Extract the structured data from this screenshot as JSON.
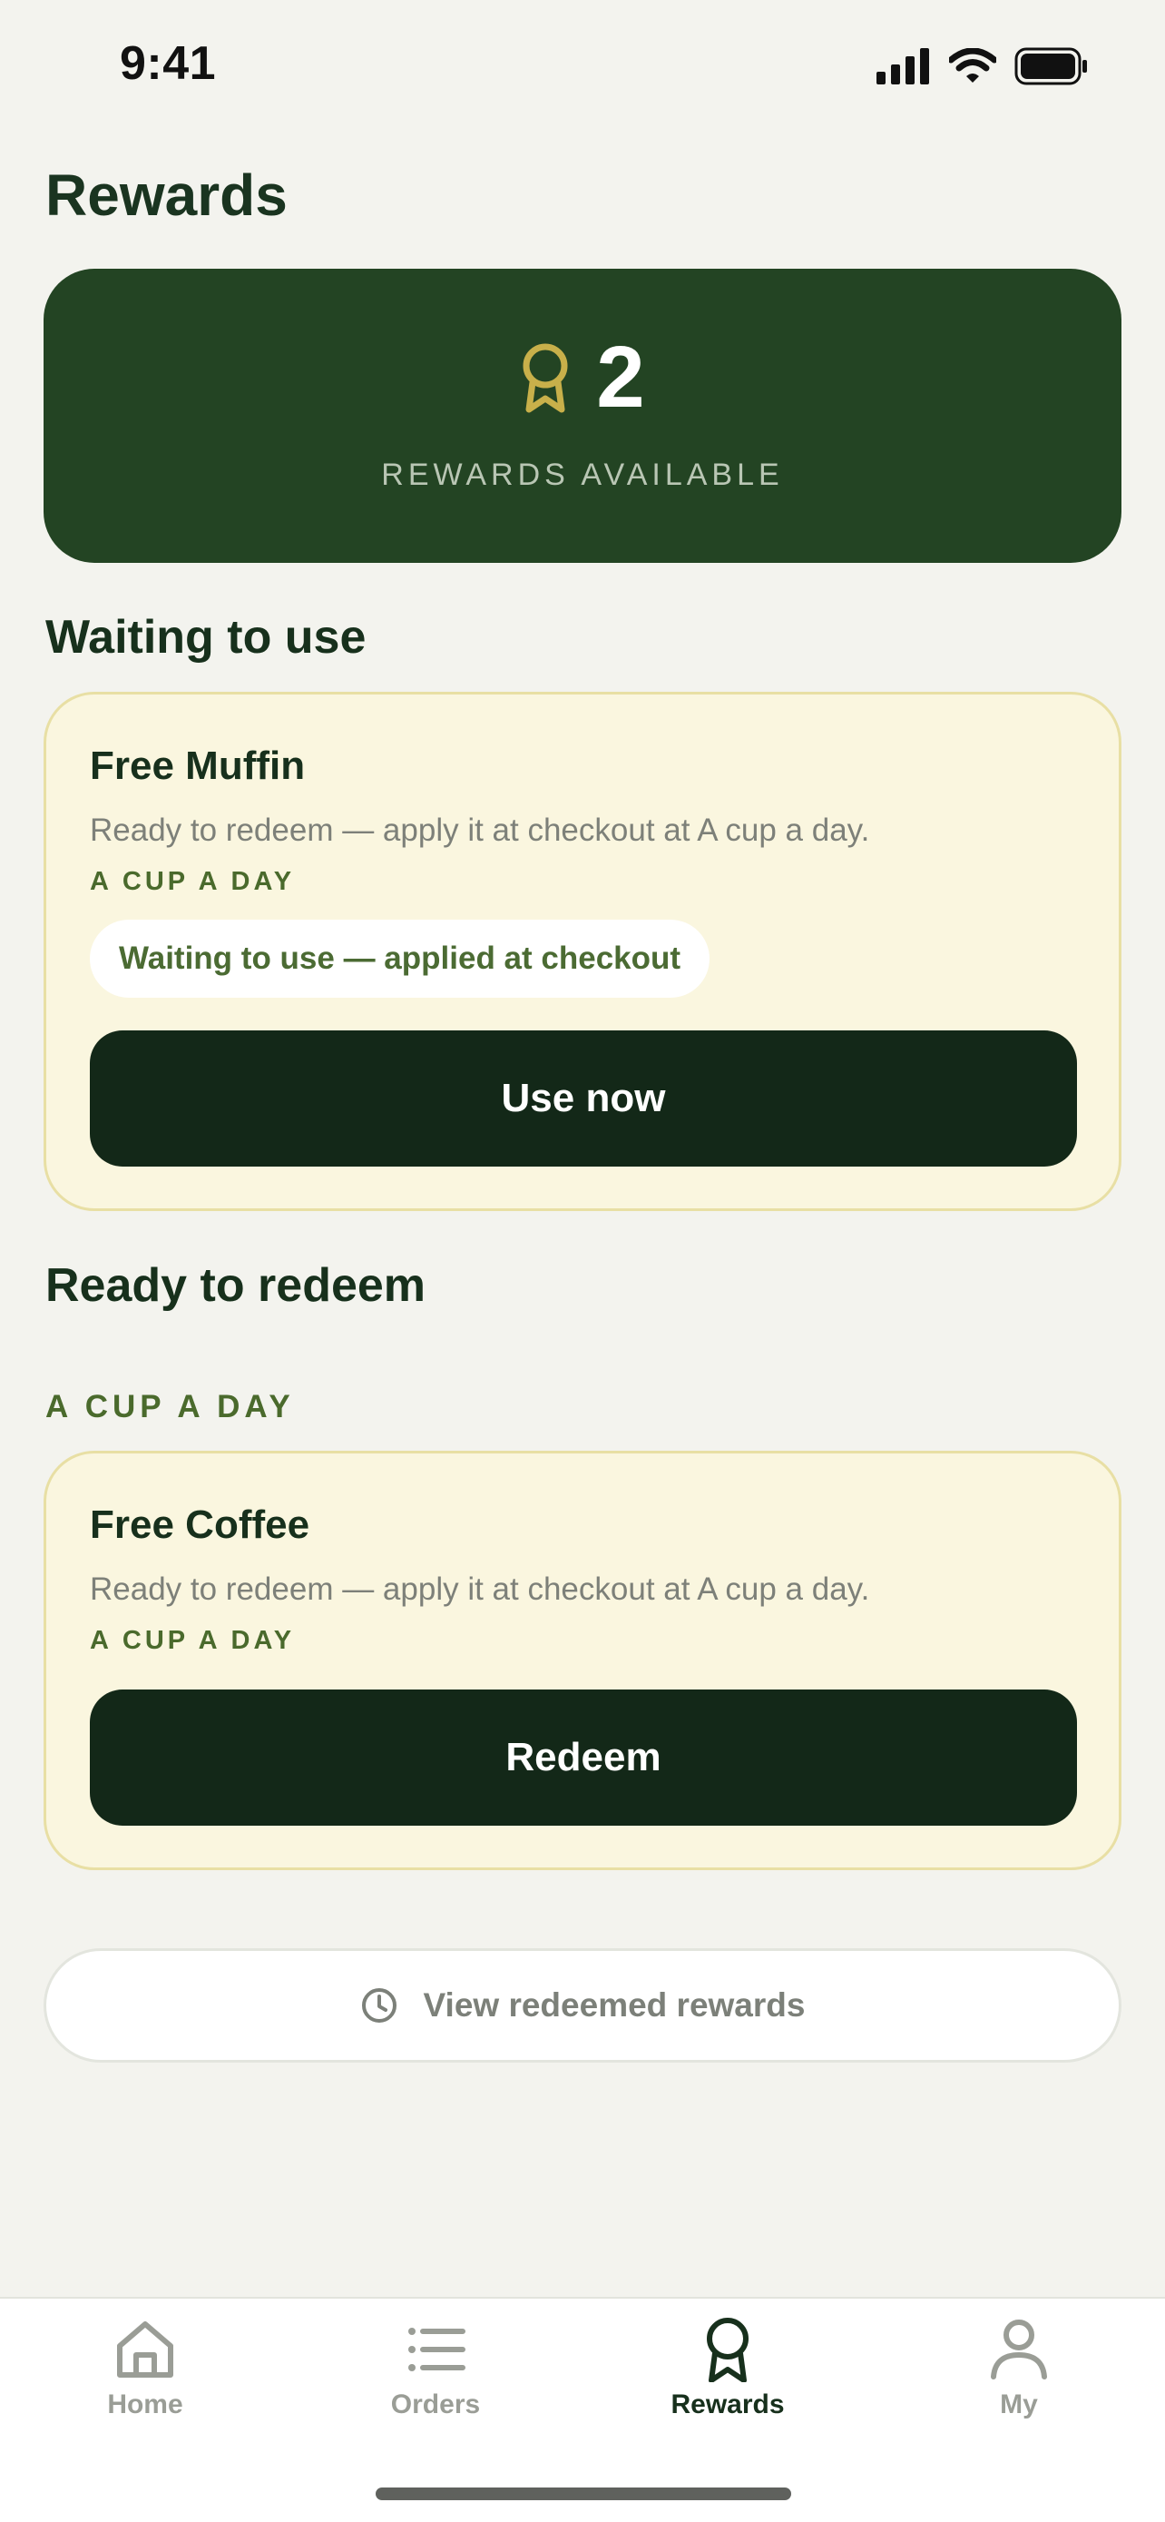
{
  "status_bar": {
    "time": "9:41"
  },
  "page_title": "Rewards",
  "summary": {
    "count": "2",
    "label": "REWARDS AVAILABLE"
  },
  "waiting": {
    "section_title": "Waiting to use",
    "card": {
      "title": "Free Muffin",
      "description": "Ready to redeem — apply it at checkout at A cup a day.",
      "merchant": "A CUP A DAY",
      "status": "Waiting to use — applied at checkout",
      "button": "Use now"
    }
  },
  "ready": {
    "section_title": "Ready to redeem",
    "group_label": "A CUP A DAY",
    "card": {
      "title": "Free Coffee",
      "description": "Ready to redeem — apply it at checkout at A cup a day.",
      "merchant": "A CUP A DAY",
      "button": "Redeem"
    }
  },
  "history_button": "View redeemed rewards",
  "tabs": [
    {
      "label": "Home",
      "icon": "home-icon"
    },
    {
      "label": "Orders",
      "icon": "list-icon"
    },
    {
      "label": "Rewards",
      "icon": "award-icon",
      "active": true
    },
    {
      "label": "My",
      "icon": "person-icon"
    }
  ],
  "colors": {
    "background": "#f3f3ee",
    "hero": "#234423",
    "card": "#faf6df",
    "button": "#132818",
    "accent_gold": "#c8b04a"
  }
}
